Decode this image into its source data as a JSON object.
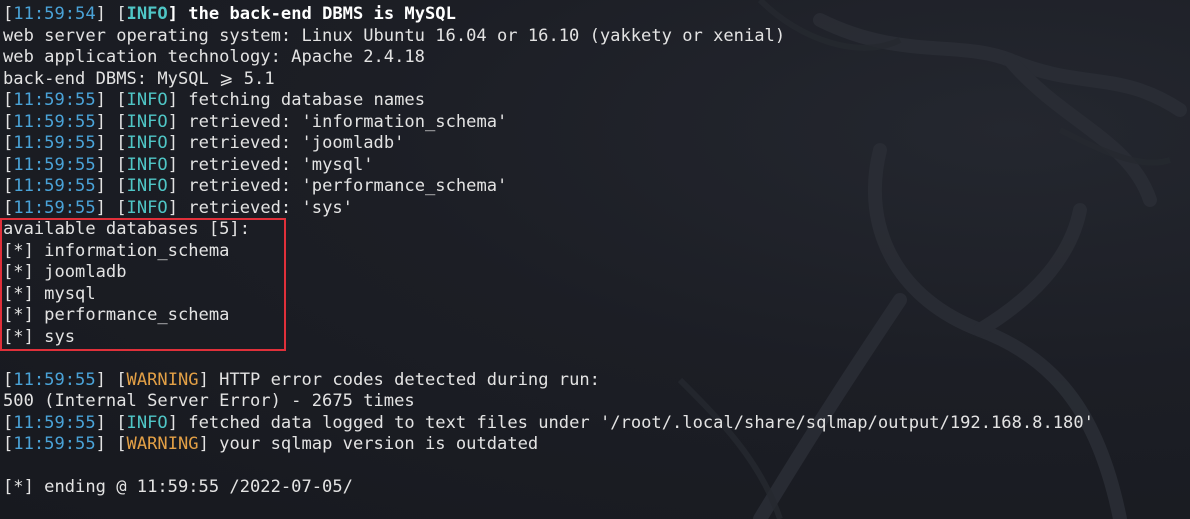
{
  "terminal": {
    "lines": [
      {
        "ts": "11:59:54",
        "level": "INFO",
        "bold": true,
        "msg": "the back-end DBMS is MySQL"
      },
      {
        "plain": "web server operating system: Linux Ubuntu 16.04 or 16.10 (yakkety or xenial)"
      },
      {
        "plain": "web application technology: Apache 2.4.18"
      },
      {
        "plain": "back-end DBMS: MySQL ⩾ 5.1"
      },
      {
        "ts": "11:59:55",
        "level": "INFO",
        "msg": "fetching database names"
      },
      {
        "ts": "11:59:55",
        "level": "INFO",
        "msg": "retrieved: 'information_schema'"
      },
      {
        "ts": "11:59:55",
        "level": "INFO",
        "msg": "retrieved: 'joomladb'"
      },
      {
        "ts": "11:59:55",
        "level": "INFO",
        "msg": "retrieved: 'mysql'"
      },
      {
        "ts": "11:59:55",
        "level": "INFO",
        "msg": "retrieved: 'performance_schema'"
      },
      {
        "ts": "11:59:55",
        "level": "INFO",
        "msg": "retrieved: 'sys'"
      },
      {
        "plain": "available databases [5]:"
      },
      {
        "plain": "[*] information_schema"
      },
      {
        "plain": "[*] joomladb"
      },
      {
        "plain": "[*] mysql"
      },
      {
        "plain": "[*] performance_schema"
      },
      {
        "plain": "[*] sys"
      },
      {
        "plain": ""
      },
      {
        "ts": "11:59:55",
        "level": "WARNING",
        "msg": "HTTP error codes detected during run:"
      },
      {
        "plain": "500 (Internal Server Error) - 2675 times"
      },
      {
        "ts": "11:59:55",
        "level": "INFO",
        "msg": "fetched data logged to text files under '/root/.local/share/sqlmap/output/192.168.8.180'"
      },
      {
        "ts": "11:59:55",
        "level": "WARNING",
        "msg": "your sqlmap version is outdated"
      },
      {
        "plain": ""
      },
      {
        "plain": "[*] ending @ 11:59:55 /2022-07-05/"
      }
    ]
  },
  "colors": {
    "background": "#1c1e25",
    "timestamp": "#4aa3d8",
    "info": "#4fc6c6",
    "warning": "#e3a046",
    "text": "#e3e3e3",
    "highlight_border": "#e0303a"
  }
}
